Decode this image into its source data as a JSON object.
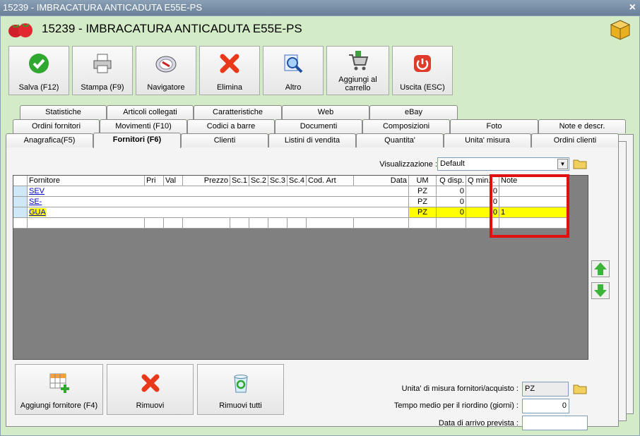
{
  "window": {
    "title": "15239 - IMBRACATURA ANTICADUTA E55E-PS",
    "close": "×"
  },
  "header": {
    "title": "15239 - IMBRACATURA ANTICADUTA E55E-PS"
  },
  "toolbar": [
    {
      "label": "Salva (F12)",
      "icon": "check-icon"
    },
    {
      "label": "Stampa (F9)",
      "icon": "printer-icon"
    },
    {
      "label": "Navigatore",
      "icon": "compass-icon"
    },
    {
      "label": "Elimina",
      "icon": "x-icon"
    },
    {
      "label": "Altro",
      "icon": "magnifier-icon"
    },
    {
      "label": "Aggiungi al carrello",
      "icon": "cart-icon"
    },
    {
      "label": "Uscita (ESC)",
      "icon": "power-icon"
    }
  ],
  "tabs": {
    "row1": [
      "Statistiche",
      "Articoli collegati",
      "Caratteristiche",
      "Web",
      "eBay"
    ],
    "row2": [
      "Ordini fornitori",
      "Movimenti (F10)",
      "Codici a barre",
      "Documenti",
      "Composizioni",
      "Foto",
      "Note e descr."
    ],
    "row3": [
      "Anagrafica(F5)",
      "Fornitori (F6)",
      "Clienti",
      "Listini di vendita",
      "Quantita'",
      "Unita' misura",
      "Ordini clienti"
    ]
  },
  "visualization": {
    "label": "Visualizzazione :",
    "value": "Default"
  },
  "grid": {
    "columns": [
      "Fornitore",
      "Pri",
      "Val",
      "Prezzo",
      "Sc.1",
      "Sc.2",
      "Sc.3",
      "Sc.4",
      "Cod. Art",
      "Data",
      "UM",
      "Q disp.",
      "Q min...",
      "Note"
    ],
    "rows": [
      {
        "fornitore": "SEV",
        "um": "PZ",
        "qdisp": "0",
        "qmin": "0",
        "note": ""
      },
      {
        "fornitore": "SE-",
        "um": "PZ",
        "qdisp": "0",
        "qmin": "0",
        "note": ""
      },
      {
        "fornitore": "GUA",
        "um": "PZ",
        "qdisp": "0",
        "qmin": "0",
        "note": "1"
      }
    ]
  },
  "bottom_buttons": [
    {
      "label": "Aggiungi fornitore (F4)",
      "icon": "add-grid-icon"
    },
    {
      "label": "Rimuovi",
      "icon": "x-icon"
    },
    {
      "label": "Rimuovi tutti",
      "icon": "recycle-bin-icon"
    }
  ],
  "fields": {
    "um_label": "Unita' di misura fornitori/acquisto :",
    "um_value": "PZ",
    "tempo_label": "Tempo medio per il riordino (giorni) :",
    "tempo_value": "0",
    "data_label": "Data di arrivo prevista :",
    "data_value": ""
  },
  "colors": {
    "accent_green": "#d3ecc7",
    "highlight": "#ffff00",
    "annotation": "#e01010"
  }
}
